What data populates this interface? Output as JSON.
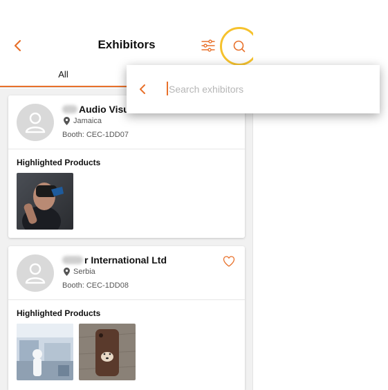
{
  "colors": {
    "accent": "#e8702a",
    "highlight_ring": "#f6c22d"
  },
  "header": {
    "title": "Exhibitors",
    "back_icon": "chevron-left-icon",
    "filter_icon": "sliders-icon",
    "search_icon": "search-icon"
  },
  "tabs": [
    {
      "label": "All",
      "active": true
    }
  ],
  "exhibitors": [
    {
      "name": "Audio Visu",
      "country": "Jamaica",
      "booth": "Booth:  CEC-1DD07",
      "highlighted_label": "Highlighted Products",
      "favorite": false
    },
    {
      "name": "r International Ltd",
      "country": "Serbia",
      "booth": "Booth:  CEC-1DD08",
      "highlighted_label": "Highlighted Products",
      "favorite": false
    }
  ],
  "search": {
    "placeholder": "Search exhibitors",
    "value": ""
  }
}
